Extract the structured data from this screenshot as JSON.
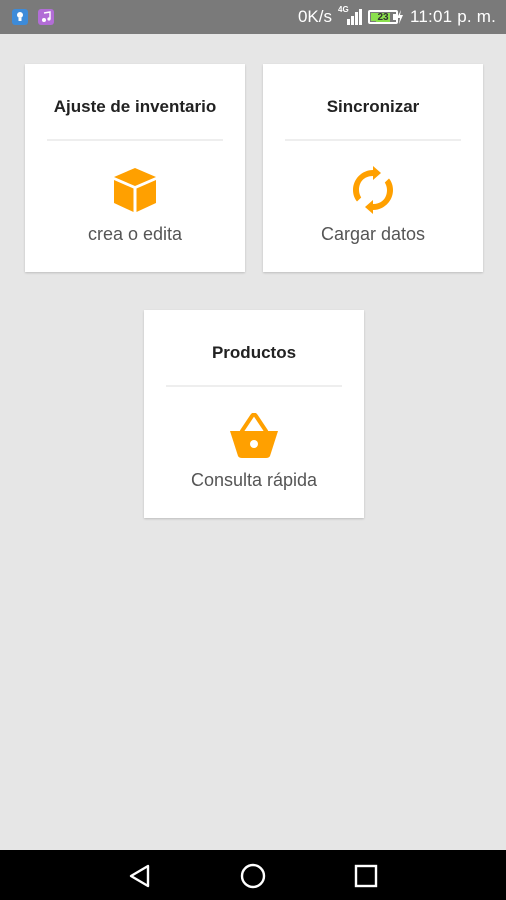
{
  "status_bar": {
    "network_speed": "0K/s",
    "network_type": "4G",
    "battery_level": "23",
    "time": "11:01 p. m."
  },
  "cards": [
    {
      "title": "Ajuste de inventario",
      "subtitle": "crea o edita",
      "icon": "box-icon"
    },
    {
      "title": "Sincronizar",
      "subtitle": "Cargar datos",
      "icon": "sync-icon"
    },
    {
      "title": "Productos",
      "subtitle": "Consulta rápida",
      "icon": "basket-icon"
    }
  ],
  "nav": {
    "back_icon": "back-triangle-icon",
    "home_icon": "home-circle-icon",
    "recents_icon": "recents-square-icon"
  },
  "colors": {
    "accent": "#ffa000",
    "background": "#e6e6e6",
    "status_bar": "#7a7a7a",
    "card": "#ffffff"
  }
}
